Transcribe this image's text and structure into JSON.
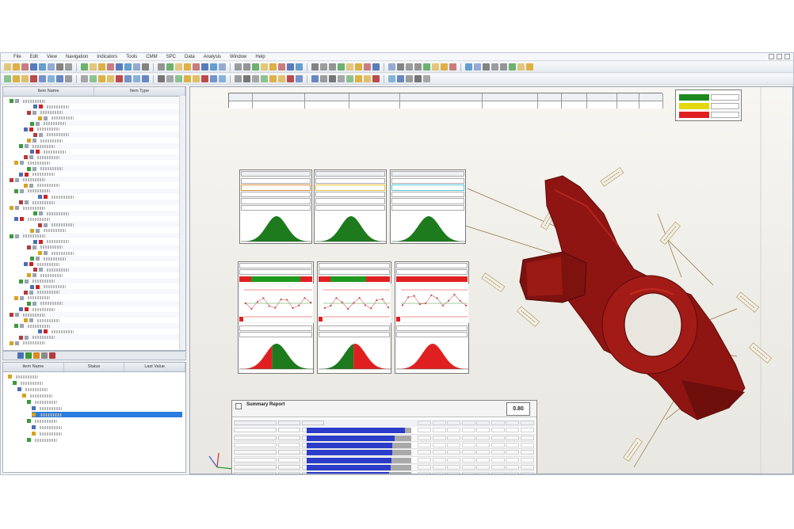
{
  "window": {
    "menus": [
      "File",
      "Edit",
      "View",
      "Navigation",
      "Indicators",
      "Tools",
      "CMM",
      "SPC",
      "Data",
      "Analysis",
      "Window",
      "Help"
    ]
  },
  "tree_panel": {
    "columns": [
      "Item Name",
      "Item Type"
    ]
  },
  "bottom_panel": {
    "columns": [
      "Item Name",
      "Status",
      "Last Value"
    ]
  },
  "summary_panel": {
    "title": "Summary Report",
    "value": "0.80"
  },
  "colors": {
    "accent": "#2b3cc9",
    "part": "#8f1512",
    "good": "#1e8a1e",
    "warning": "#e2d80b",
    "bad": "#e02020"
  },
  "legend_levels": [
    "good",
    "warning",
    "bad"
  ]
}
